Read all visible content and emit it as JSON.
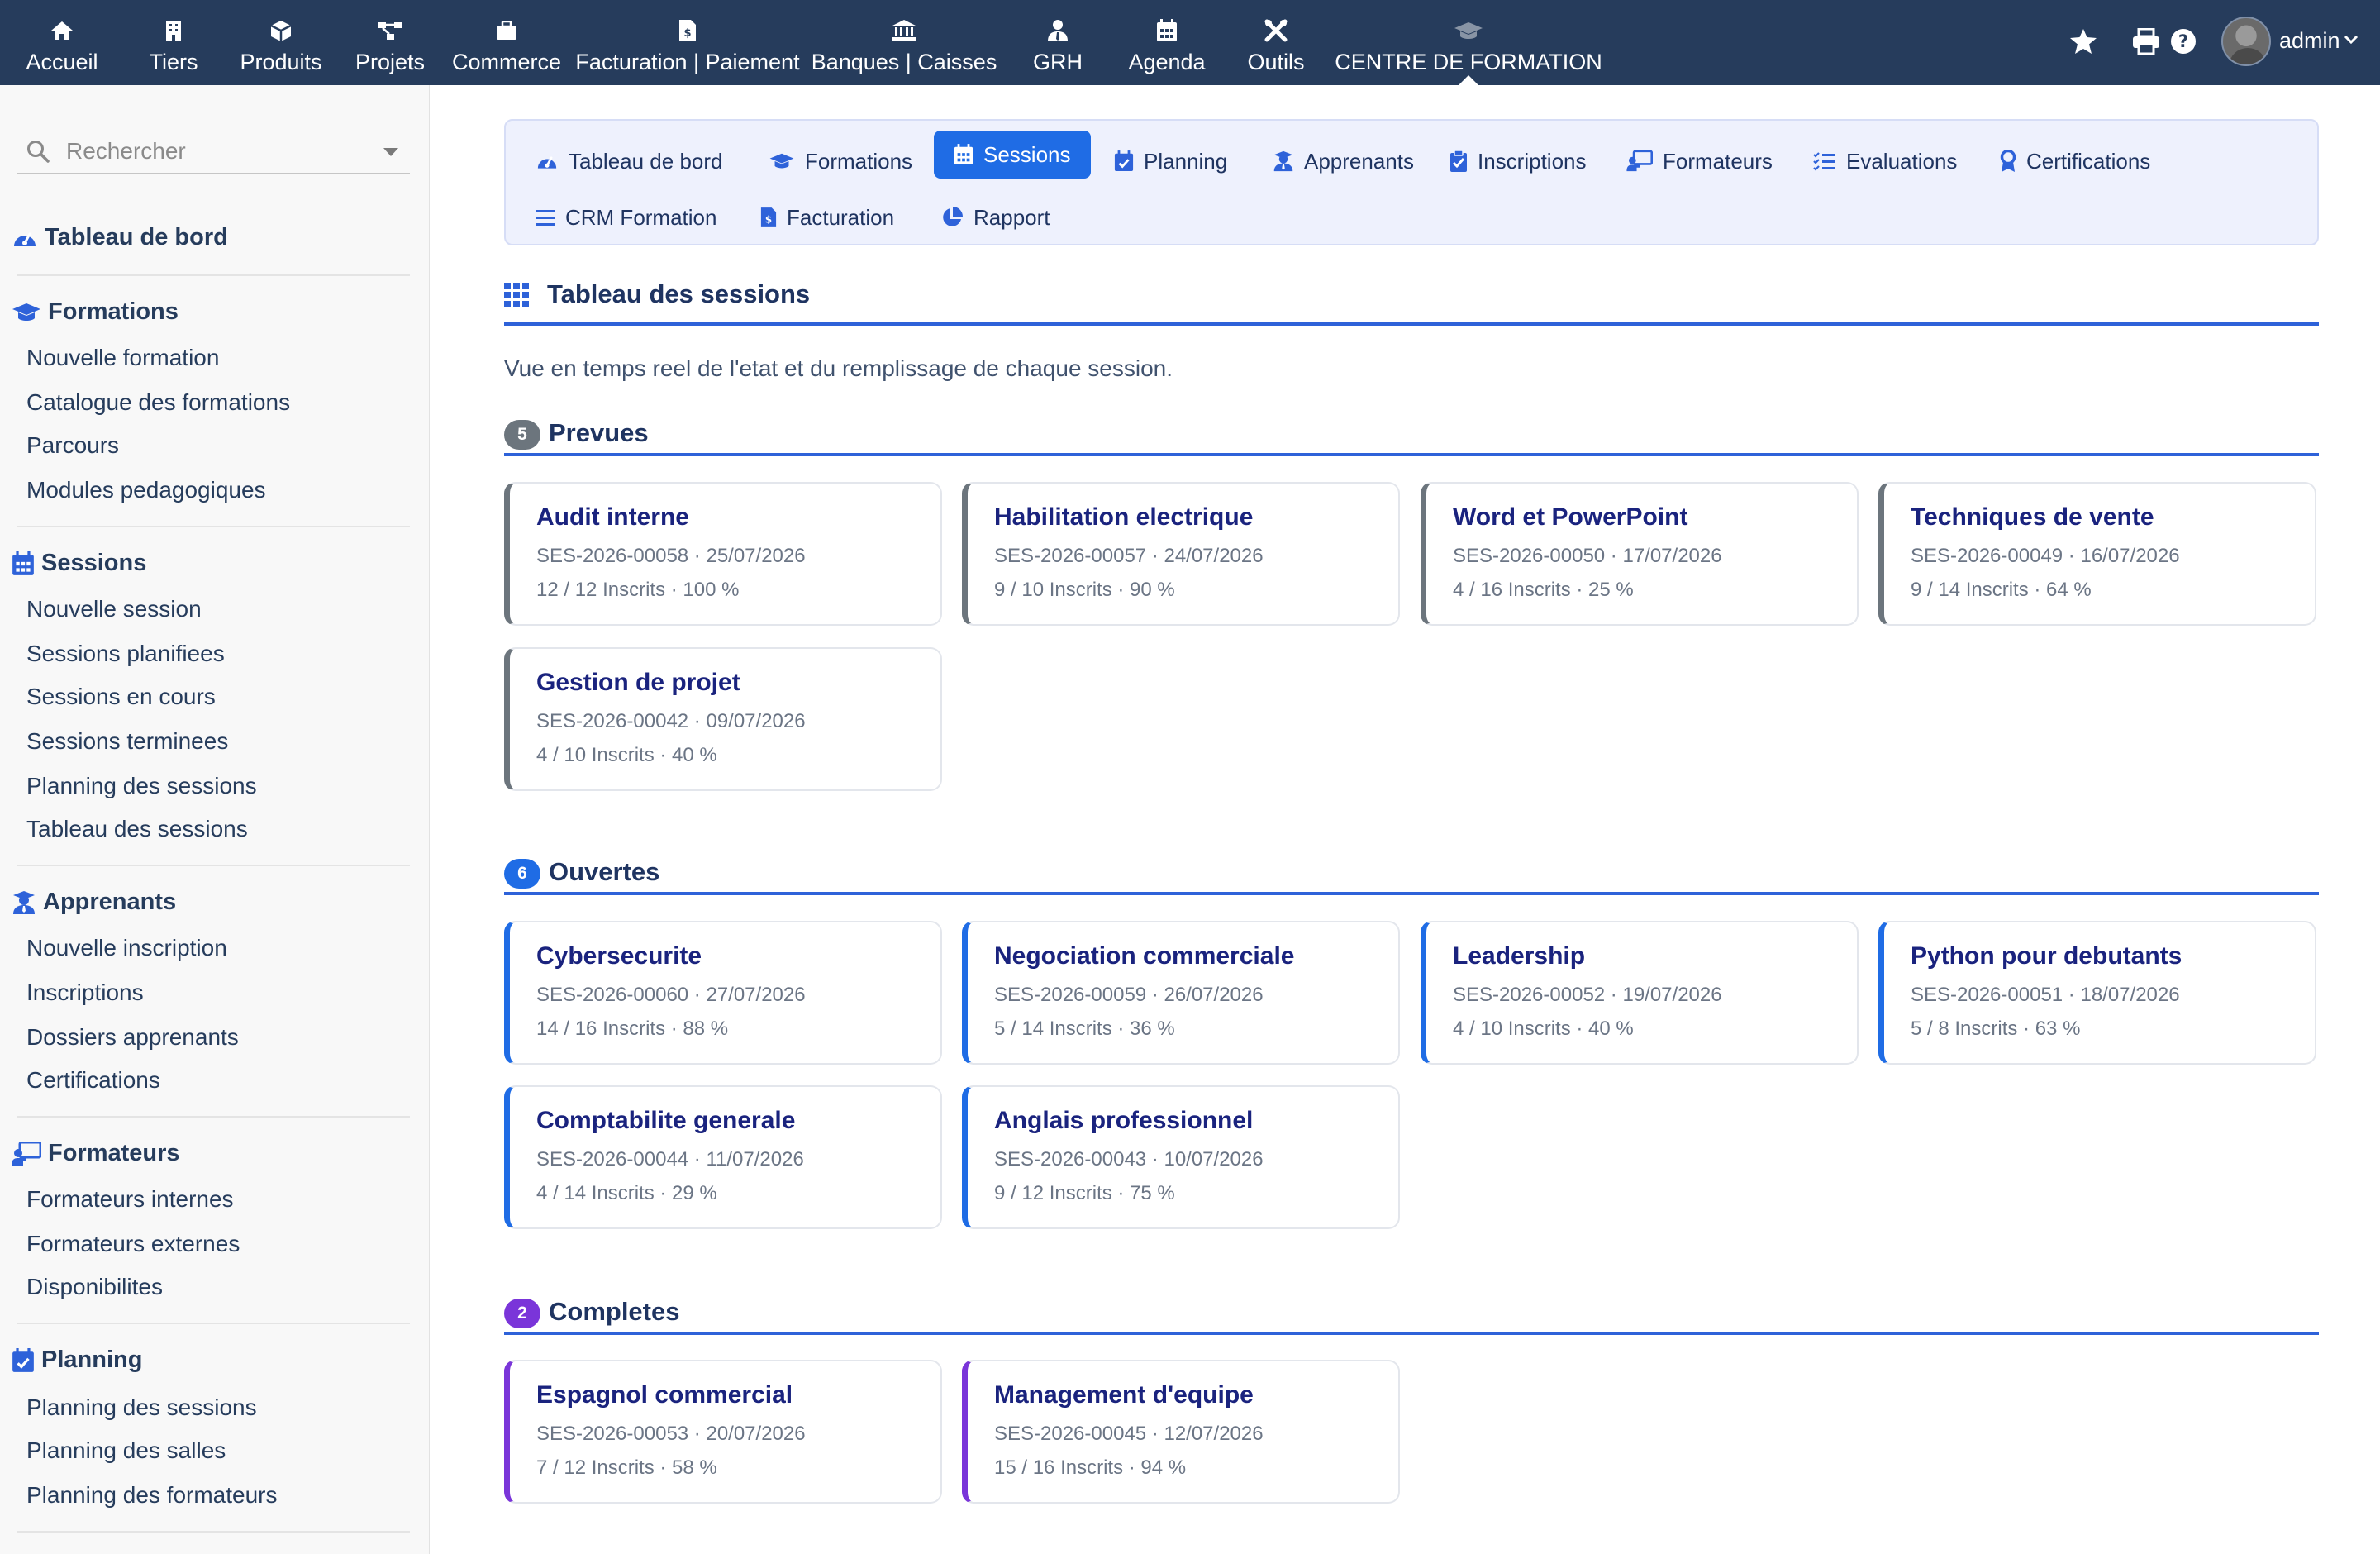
{
  "topbar": {
    "menu": [
      {
        "label": "Accueil",
        "icon": "home-icon"
      },
      {
        "label": "Tiers",
        "icon": "building-icon"
      },
      {
        "label": "Produits",
        "icon": "cube-icon"
      },
      {
        "label": "Projets",
        "icon": "project-diagram-icon"
      },
      {
        "label": "Commerce",
        "icon": "suitcase-icon"
      },
      {
        "label": "Facturation | Paiement",
        "icon": "invoice-icon"
      },
      {
        "label": "Banques | Caisses",
        "icon": "bank-icon"
      },
      {
        "label": "GRH",
        "icon": "user-tie-icon"
      },
      {
        "label": "Agenda",
        "icon": "calendar-icon"
      },
      {
        "label": "Outils",
        "icon": "tools-icon"
      },
      {
        "label": "CENTRE DE FORMATION",
        "icon": "graduation-cap-icon"
      }
    ],
    "active_menu": "CENTRE DE FORMATION",
    "username": "admin"
  },
  "sidebar": {
    "search_placeholder": "Rechercher",
    "dashboard_label": "Tableau de bord",
    "sections": [
      {
        "title": "Formations",
        "icon": "graduation-cap-icon",
        "items": [
          "Nouvelle formation",
          "Catalogue des formations",
          "Parcours",
          "Modules pedagogiques"
        ]
      },
      {
        "title": "Sessions",
        "icon": "calendar-icon",
        "items": [
          "Nouvelle session",
          "Sessions planifiees",
          "Sessions en cours",
          "Sessions terminees",
          "Planning des sessions",
          "Tableau des sessions"
        ]
      },
      {
        "title": "Apprenants",
        "icon": "user-graduate-icon",
        "items": [
          "Nouvelle inscription",
          "Inscriptions",
          "Dossiers apprenants",
          "Certifications"
        ]
      },
      {
        "title": "Formateurs",
        "icon": "chalkboard-teacher-icon",
        "items": [
          "Formateurs internes",
          "Formateurs externes",
          "Disponibilites"
        ]
      },
      {
        "title": "Planning",
        "icon": "calendar-check-icon",
        "items": [
          "Planning des sessions",
          "Planning des salles",
          "Planning des formateurs"
        ]
      }
    ]
  },
  "tabs": [
    {
      "label": "Tableau de bord",
      "icon": "gauge-icon"
    },
    {
      "label": "Formations",
      "icon": "graduation-cap-icon"
    },
    {
      "label": "Sessions",
      "icon": "calendar-icon"
    },
    {
      "label": "Planning",
      "icon": "calendar-check-icon"
    },
    {
      "label": "Apprenants",
      "icon": "user-graduate-icon"
    },
    {
      "label": "Inscriptions",
      "icon": "clipboard-check-icon"
    },
    {
      "label": "Formateurs",
      "icon": "chalkboard-teacher-icon"
    },
    {
      "label": "Evaluations",
      "icon": "list-check-icon"
    },
    {
      "label": "Certifications",
      "icon": "certificate-icon"
    },
    {
      "label": "CRM Formation",
      "icon": "bars-icon"
    },
    {
      "label": "Facturation",
      "icon": "invoice-icon"
    },
    {
      "label": "Rapport",
      "icon": "pie-chart-icon"
    }
  ],
  "active_tab": "Sessions",
  "page": {
    "title": "Tableau des sessions",
    "subtitle": "Vue en temps reel de l'etat et du remplissage de chaque session."
  },
  "groups": [
    {
      "count": "5",
      "title": "Prevues",
      "color": "#6c757d",
      "sessions": [
        {
          "title": "Audit interne",
          "ref": "SES-2026-00058 · 25/07/2026",
          "stats": "12 / 12 Inscrits · 100 %"
        },
        {
          "title": "Habilitation electrique",
          "ref": "SES-2026-00057 · 24/07/2026",
          "stats": "9 / 10 Inscrits · 90 %"
        },
        {
          "title": "Word et PowerPoint",
          "ref": "SES-2026-00050 · 17/07/2026",
          "stats": "4 / 16 Inscrits · 25 %"
        },
        {
          "title": "Techniques de vente",
          "ref": "SES-2026-00049 · 16/07/2026",
          "stats": "9 / 14 Inscrits · 64 %"
        },
        {
          "title": "Gestion de projet",
          "ref": "SES-2026-00042 · 09/07/2026",
          "stats": "4 / 10 Inscrits · 40 %"
        }
      ]
    },
    {
      "count": "6",
      "title": "Ouvertes",
      "color": "#1f6ce5",
      "sessions": [
        {
          "title": "Cybersecurite",
          "ref": "SES-2026-00060 · 27/07/2026",
          "stats": "14 / 16 Inscrits · 88 %"
        },
        {
          "title": "Negociation commerciale",
          "ref": "SES-2026-00059 · 26/07/2026",
          "stats": "5 / 14 Inscrits · 36 %"
        },
        {
          "title": "Leadership",
          "ref": "SES-2026-00052 · 19/07/2026",
          "stats": "4 / 10 Inscrits · 40 %"
        },
        {
          "title": "Python pour debutants",
          "ref": "SES-2026-00051 · 18/07/2026",
          "stats": "5 / 8 Inscrits · 63 %"
        },
        {
          "title": "Comptabilite generale",
          "ref": "SES-2026-00044 · 11/07/2026",
          "stats": "4 / 14 Inscrits · 29 %"
        },
        {
          "title": "Anglais professionnel",
          "ref": "SES-2026-00043 · 10/07/2026",
          "stats": "9 / 12 Inscrits · 75 %"
        }
      ]
    },
    {
      "count": "2",
      "title": "Completes",
      "color": "#7a35d9",
      "sessions": [
        {
          "title": "Espagnol commercial",
          "ref": "SES-2026-00053 · 20/07/2026",
          "stats": "7 / 12 Inscrits · 58 %"
        },
        {
          "title": "Management d'equipe",
          "ref": "SES-2026-00045 · 12/07/2026",
          "stats": "15 / 16 Inscrits · 94 %"
        }
      ]
    }
  ]
}
